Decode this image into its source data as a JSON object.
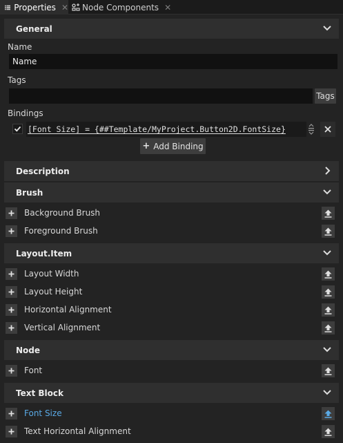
{
  "tabs": [
    {
      "label": "Properties",
      "icon": "list-icon",
      "active": true
    },
    {
      "label": "Node Components",
      "icon": "node-components-icon",
      "active": false
    }
  ],
  "general": {
    "title": "General",
    "name_label": "Name",
    "name_value": "Name",
    "tags_label": "Tags",
    "tags_value": "",
    "tags_button": "Tags",
    "bindings_label": "Bindings",
    "binding_text": "[Font Size] = {##Template/MyProject.Button2D.FontSize}",
    "binding_checked": true,
    "add_binding_label": "Add Binding"
  },
  "sections": {
    "description": {
      "title": "Description",
      "expanded": false
    },
    "brush": {
      "title": "Brush",
      "expanded": true,
      "items": [
        "Background Brush",
        "Foreground Brush"
      ]
    },
    "layout_item": {
      "title": "Layout.Item",
      "expanded": true,
      "items": [
        "Layout Width",
        "Layout Height",
        "Horizontal Alignment",
        "Vertical Alignment"
      ]
    },
    "node": {
      "title": "Node",
      "expanded": true,
      "items": [
        "Font"
      ]
    },
    "text_block": {
      "title": "Text Block",
      "expanded": true,
      "items": [
        "Font Size",
        "Text Horizontal Alignment"
      ]
    }
  },
  "colors": {
    "background": "#232323",
    "section_header": "#2f2f2f",
    "field": "#111111",
    "button": "#3d3d3d",
    "accent_bound": "#5aaae6"
  }
}
